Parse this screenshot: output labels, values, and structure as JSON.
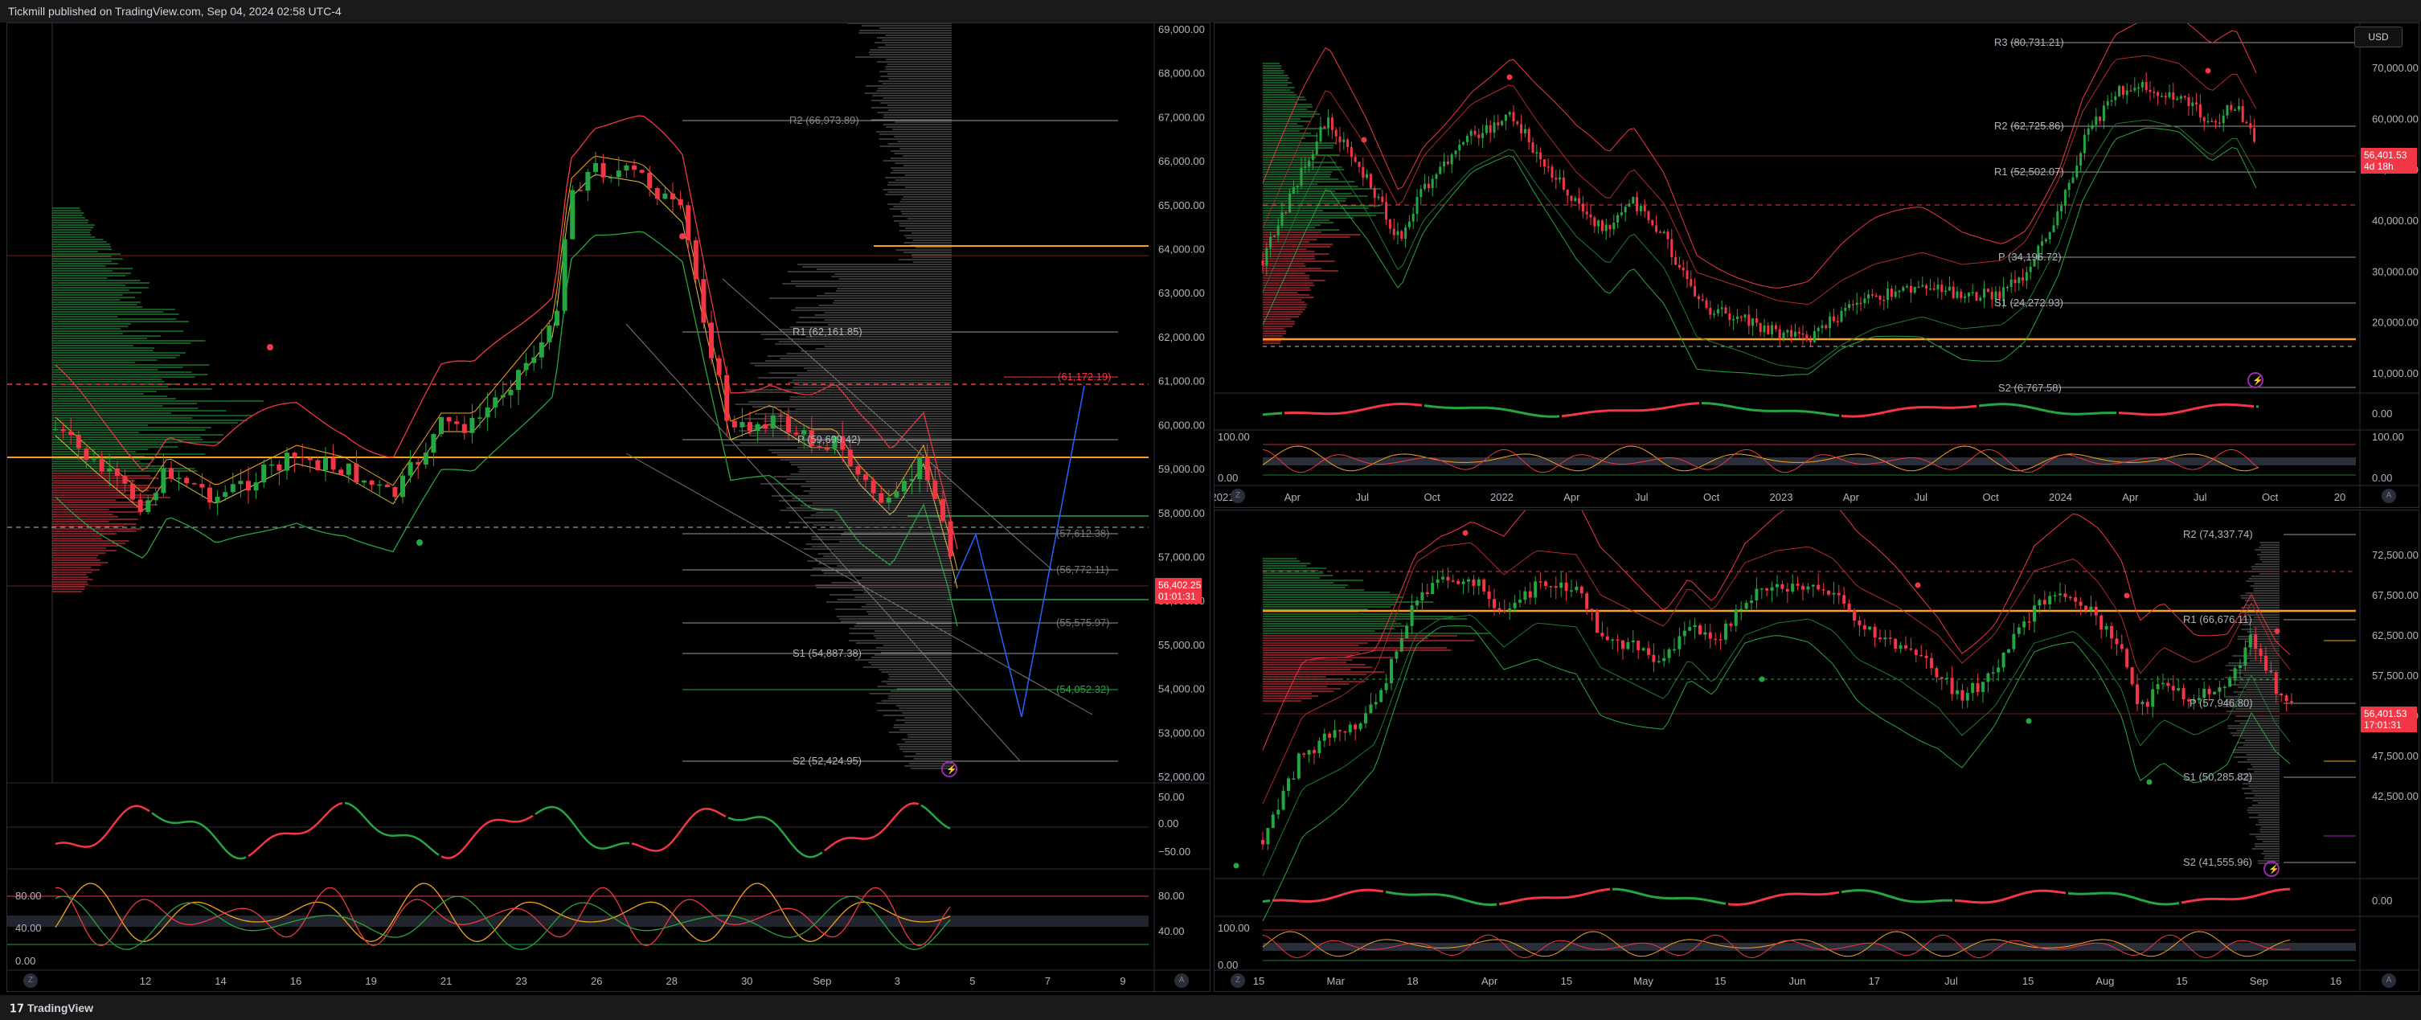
{
  "header": {
    "publisher": "Tickmill published on TradingView.com, Sep 04, 2024 02:58 UTC-4"
  },
  "footer": {
    "logo": "TradingView"
  },
  "left_chart": {
    "price_axis": [
      "69,000.00",
      "68,000.00",
      "67,000.00",
      "66,000.00",
      "65,000.00",
      "64,000.00",
      "63,000.00",
      "62,000.00",
      "61,000.00",
      "60,000.00",
      "59,000.00",
      "58,000.00",
      "57,000.00",
      "56,000.00",
      "55,000.00",
      "54,000.00",
      "53,000.00",
      "52,000.00"
    ],
    "current_price": "56,402.25",
    "current_time": "01:01:31",
    "pivots": {
      "r2": "R2 (66,973.89)",
      "r1": "R1 (62,161.85)",
      "red": "(61,172.19)",
      "p": "P (59,699.42)",
      "l1": "(57,612.38)",
      "l2": "(56,772.11)",
      "l3": "(55,575.97)",
      "s1": "S1 (54,887.38)",
      "l4": "(54,052.32)",
      "s2": "S2 (52,424.95)"
    },
    "time_axis": [
      "12",
      "14",
      "16",
      "19",
      "21",
      "23",
      "26",
      "28",
      "30",
      "Sep",
      "3",
      "5",
      "7",
      "9"
    ],
    "osc1_axis": [
      "50.00",
      "0.00",
      "−50.00"
    ],
    "osc2_axis_left": [
      "80.00",
      "40.00",
      "0.00"
    ],
    "osc2_axis_right": [
      "80.00",
      "40.00"
    ],
    "zoom_button": "Z",
    "auto_button": "A"
  },
  "tr_chart": {
    "currency": "USD",
    "price_axis": [
      "70,000.00",
      "60,000.00",
      "50,000.00",
      "40,000.00",
      "30,000.00",
      "20,000.00",
      "10,000.00"
    ],
    "current_price": "56,401.53",
    "current_time": "4d 18h",
    "pivots": {
      "r3": "R3 (80,731.21)",
      "r2": "R2 (62,725.86)",
      "r1": "R1 (52,502.07)",
      "p": "P (34,196.72)",
      "s1": "S1 (24,272.93)",
      "s2": "S2 (6,767.58)"
    },
    "time_axis": [
      "2021",
      "Apr",
      "Jul",
      "Oct",
      "2022",
      "Apr",
      "Jul",
      "Oct",
      "2023",
      "Apr",
      "Jul",
      "Oct",
      "2024",
      "Apr",
      "Jul",
      "Oct",
      "20"
    ],
    "osc1_axis": [
      "0.00"
    ],
    "osc2_axis": [
      "100.00",
      "0.00"
    ],
    "osc2_axis_left": [
      "100.00",
      "0.00"
    ]
  },
  "br_chart": {
    "price_axis": [
      "72,500.00",
      "67,500.00",
      "62,500.00",
      "57,500.00",
      "52,500.00",
      "47,500.00",
      "42,500.00"
    ],
    "current_price": "56,401.53",
    "current_time": "17:01:31",
    "pivots": {
      "r2": "R2 (74,337.74)",
      "r1": "R1 (66,676.11)",
      "p": "P (57,946.80)",
      "s1": "S1 (50,285.82)",
      "s2": "S2 (41,555.96)"
    },
    "time_axis": [
      "15",
      "Mar",
      "18",
      "Apr",
      "15",
      "May",
      "15",
      "Jun",
      "17",
      "Jul",
      "15",
      "Aug",
      "15",
      "Sep",
      "16"
    ],
    "osc1_axis": [
      "0.00"
    ],
    "osc2_axis": [
      "100.00",
      "0.00"
    ]
  },
  "colors": {
    "bull": "#26a641",
    "bear": "#f23645",
    "orange": "#f7a21b",
    "background": "#000000"
  }
}
